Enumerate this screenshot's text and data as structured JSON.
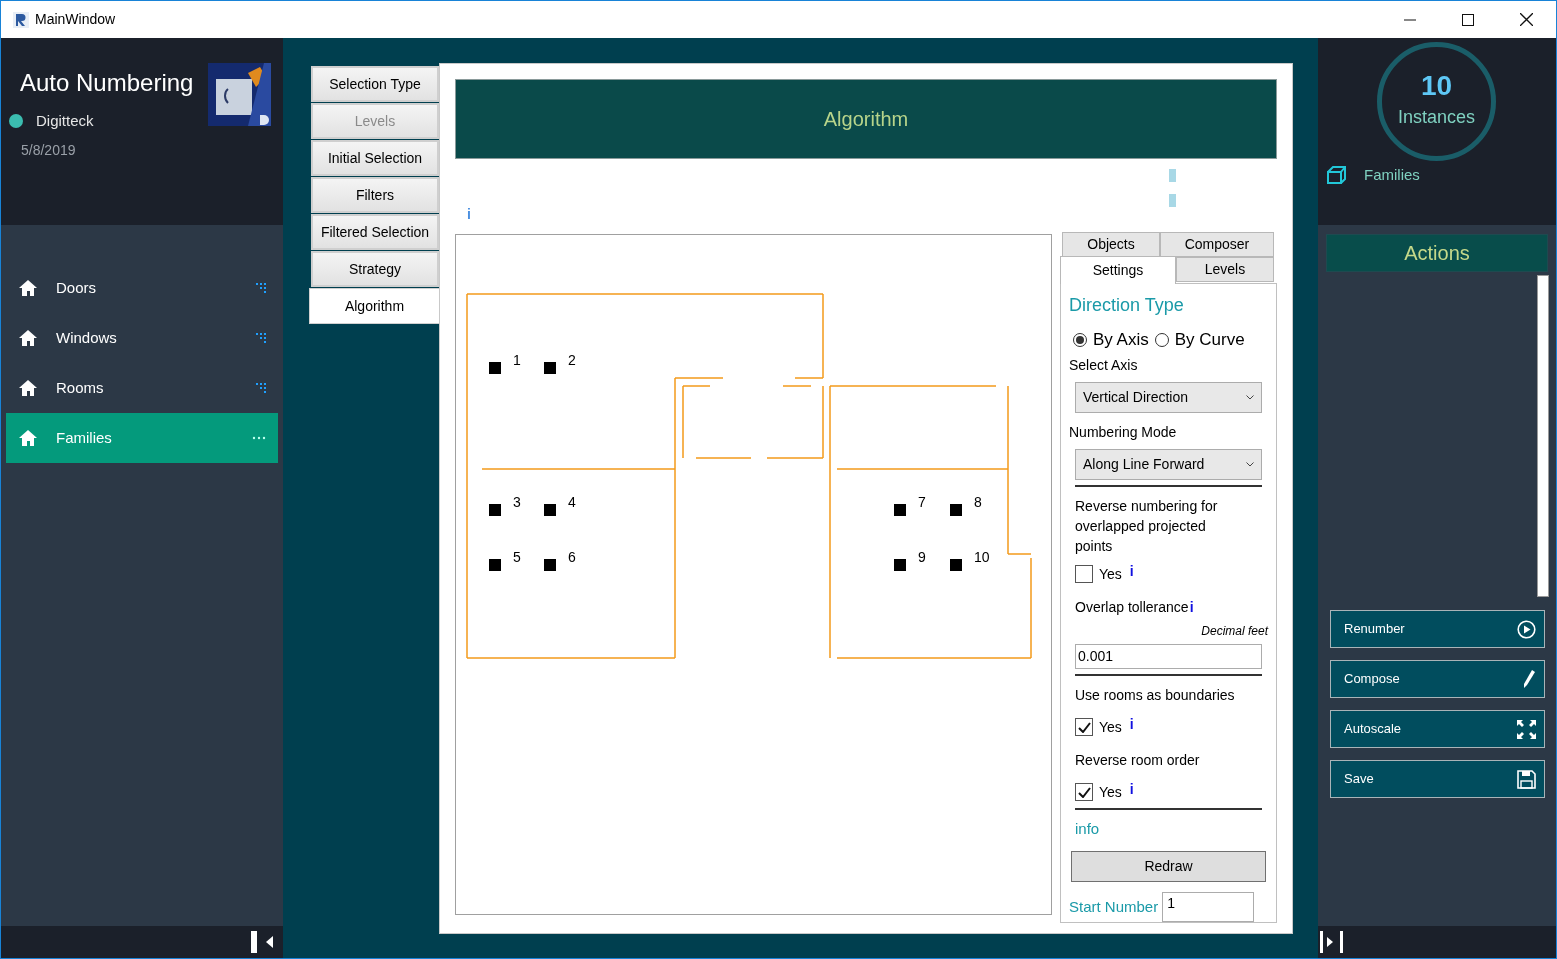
{
  "window": {
    "title": "MainWindow"
  },
  "sidebar": {
    "app_title": "Auto Numbering",
    "company": "Digitteck",
    "date": "5/8/2019",
    "items": [
      {
        "label": "Doors",
        "selected": false
      },
      {
        "label": "Windows",
        "selected": false
      },
      {
        "label": "Rooms",
        "selected": false
      },
      {
        "label": "Families",
        "selected": true
      }
    ]
  },
  "steps": [
    {
      "label": "Selection Type",
      "selected": false,
      "disabled": false
    },
    {
      "label": "Levels",
      "selected": false,
      "disabled": true
    },
    {
      "label": "Initial Selection",
      "selected": false,
      "disabled": false
    },
    {
      "label": "Filters",
      "selected": false,
      "disabled": false
    },
    {
      "label": "Filtered Selection",
      "selected": false,
      "disabled": false
    },
    {
      "label": "Strategy",
      "selected": false,
      "disabled": false
    },
    {
      "label": "Algorithm",
      "selected": true,
      "disabled": false
    }
  ],
  "main": {
    "header": "Algorithm",
    "info_mark": "i",
    "points": [
      {
        "label": "1"
      },
      {
        "label": "2"
      },
      {
        "label": "3"
      },
      {
        "label": "4"
      },
      {
        "label": "7"
      },
      {
        "label": "8"
      },
      {
        "label": "5"
      },
      {
        "label": "6"
      },
      {
        "label": "9"
      },
      {
        "label": "10"
      }
    ]
  },
  "settings": {
    "tabs": [
      {
        "label": "Objects",
        "selected": false
      },
      {
        "label": "Composer",
        "selected": false
      },
      {
        "label": "Settings",
        "selected": true
      },
      {
        "label": "Levels",
        "selected": false
      }
    ],
    "direction_heading": "Direction Type",
    "direction_options": [
      {
        "label": "By Axis",
        "selected": true
      },
      {
        "label": "By Curve",
        "selected": false
      }
    ],
    "select_axis_label": "Select Axis",
    "select_axis_value": "Vertical Direction",
    "numbering_mode_label": "Numbering Mode",
    "numbering_mode_value": "Along Line Forward",
    "reverse_overlap": {
      "label": "Reverse numbering for overlapped projected points",
      "option": "Yes",
      "checked": false,
      "info": "i"
    },
    "overlap_tolerance": {
      "label": "Overlap tollerance",
      "info": "i",
      "unit": "Decimal feet",
      "value": "0.001"
    },
    "use_rooms": {
      "label": "Use rooms as boundaries",
      "option": "Yes",
      "checked": true,
      "info": "i"
    },
    "reverse_room_order": {
      "label": "Reverse room order",
      "option": "Yes",
      "checked": true,
      "info": "i"
    },
    "info_link": "info",
    "redraw_button": "Redraw",
    "start_number": {
      "label": "Start Number",
      "value": "1"
    }
  },
  "summary": {
    "count": "10",
    "count_label": "Instances",
    "category": "Families"
  },
  "actions": {
    "title": "Actions",
    "buttons": [
      {
        "label": "Renumber",
        "kind": "play"
      },
      {
        "label": "Compose",
        "kind": "pencil"
      },
      {
        "label": "Autoscale",
        "kind": "expand"
      },
      {
        "label": "Save",
        "kind": "save"
      }
    ]
  }
}
